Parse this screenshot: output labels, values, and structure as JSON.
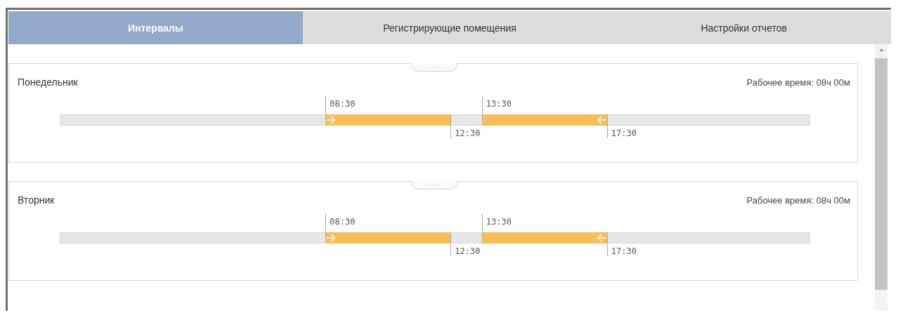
{
  "tabs": [
    {
      "label": "Интервалы",
      "selected": true
    },
    {
      "label": "Регистрирующие помещения",
      "selected": false
    },
    {
      "label": "Настройки отчетов",
      "selected": false
    }
  ],
  "days": [
    {
      "name": "Понедельник",
      "work_time": "Рабочее время: 08ч 00м",
      "intervals": [
        {
          "start": "08:30",
          "end": "12:30"
        },
        {
          "start": "13:30",
          "end": "17:30"
        }
      ]
    },
    {
      "name": "Вторник",
      "work_time": "Рабочее время: 08ч 00м",
      "intervals": [
        {
          "start": "08:30",
          "end": "12:30"
        },
        {
          "start": "13:30",
          "end": "17:30"
        }
      ]
    }
  ]
}
